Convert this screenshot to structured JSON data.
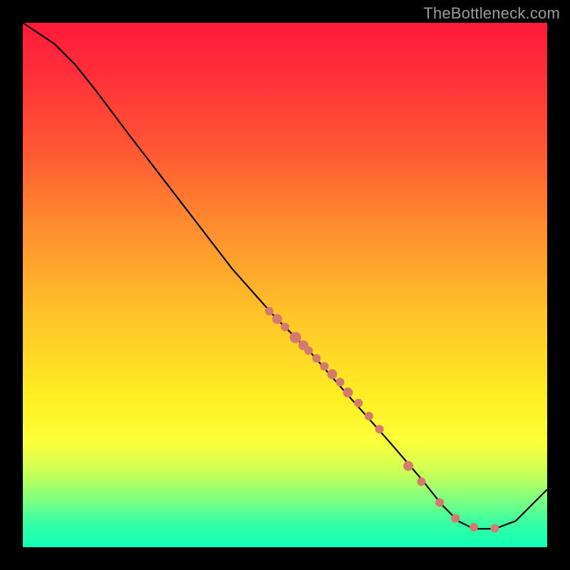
{
  "watermark": "TheBottleneck.com",
  "colors": {
    "dot": "#d47a6e",
    "curve": "#000000",
    "frame": "#000000"
  },
  "chart_data": {
    "type": "line",
    "title": "",
    "xlabel": "",
    "ylabel": "",
    "xlim": [
      0,
      100
    ],
    "ylim": [
      0,
      100
    ],
    "curve": [
      {
        "x": 0,
        "y": 100
      },
      {
        "x": 6,
        "y": 96
      },
      {
        "x": 10,
        "y": 92
      },
      {
        "x": 14,
        "y": 87
      },
      {
        "x": 20,
        "y": 79
      },
      {
        "x": 30,
        "y": 66
      },
      {
        "x": 40,
        "y": 53
      },
      {
        "x": 48,
        "y": 44
      },
      {
        "x": 55,
        "y": 37
      },
      {
        "x": 62,
        "y": 29
      },
      {
        "x": 70,
        "y": 20
      },
      {
        "x": 76,
        "y": 13
      },
      {
        "x": 80,
        "y": 8
      },
      {
        "x": 83,
        "y": 5
      },
      {
        "x": 86,
        "y": 3.5
      },
      {
        "x": 90,
        "y": 3.5
      },
      {
        "x": 94,
        "y": 5
      },
      {
        "x": 100,
        "y": 11
      }
    ],
    "dots": [
      {
        "x": 47,
        "y": 45,
        "r": 6
      },
      {
        "x": 48.5,
        "y": 43.5,
        "r": 7
      },
      {
        "x": 50,
        "y": 42,
        "r": 6
      },
      {
        "x": 52,
        "y": 40,
        "r": 8
      },
      {
        "x": 53.5,
        "y": 38.5,
        "r": 7
      },
      {
        "x": 54.5,
        "y": 37.5,
        "r": 6
      },
      {
        "x": 56,
        "y": 36,
        "r": 6
      },
      {
        "x": 57.5,
        "y": 34.5,
        "r": 6
      },
      {
        "x": 59,
        "y": 33,
        "r": 7
      },
      {
        "x": 60.5,
        "y": 31.5,
        "r": 6
      },
      {
        "x": 62,
        "y": 29.5,
        "r": 7
      },
      {
        "x": 64,
        "y": 27.5,
        "r": 6
      },
      {
        "x": 66,
        "y": 25,
        "r": 6
      },
      {
        "x": 68,
        "y": 22.5,
        "r": 6
      },
      {
        "x": 73.5,
        "y": 15.5,
        "r": 7
      },
      {
        "x": 76,
        "y": 12.5,
        "r": 6
      },
      {
        "x": 79.5,
        "y": 8.5,
        "r": 6
      },
      {
        "x": 82.5,
        "y": 5.5,
        "r": 6
      },
      {
        "x": 86,
        "y": 3.8,
        "r": 6
      },
      {
        "x": 90,
        "y": 3.6,
        "r": 6
      }
    ]
  }
}
